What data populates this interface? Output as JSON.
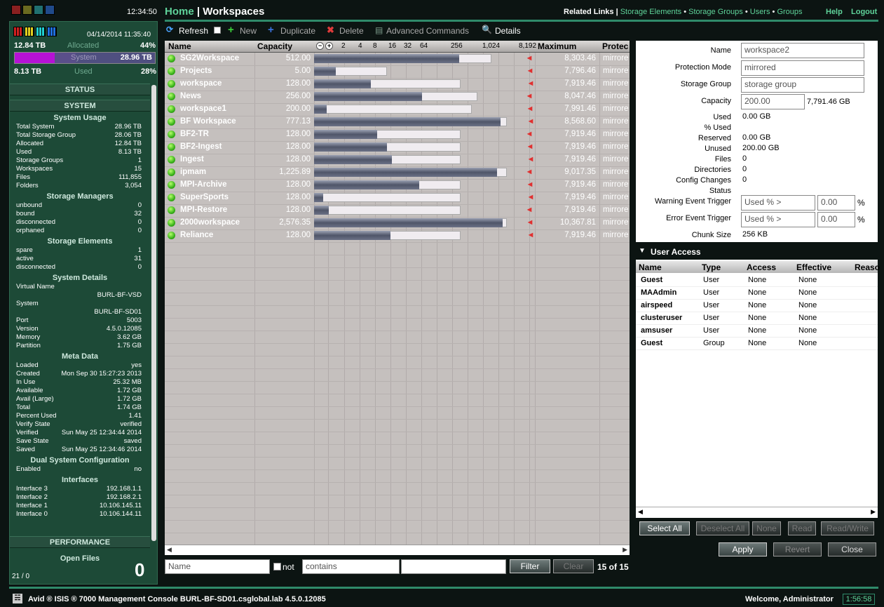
{
  "topbar": {
    "time": "12:34:50",
    "home": "Home",
    "sep": "|",
    "page": "Workspaces",
    "related": "Related Links |",
    "links": [
      "Storage Elements",
      "Storage Groups",
      "Users",
      "Groups"
    ],
    "help": "Help",
    "logout": "Logout"
  },
  "summary": {
    "date": "04/14/2014 11:35:40",
    "allocated_tb": "12.84 TB",
    "allocated_label": "Allocated",
    "allocated_pct": "44%",
    "system_label": "System",
    "system_tb": "28.96 TB",
    "used_tb": "8.13 TB",
    "used_label": "Used",
    "used_pct": "28%"
  },
  "left": {
    "status": "STATUS",
    "system": "SYSTEM",
    "sections": [
      {
        "title": "System Usage",
        "rows": [
          [
            "Total System",
            "28.96 TB"
          ],
          [
            "Total Storage Group",
            "28.06 TB"
          ],
          [
            "Allocated",
            "12.84 TB"
          ],
          [
            "Used",
            "8.13 TB"
          ],
          [
            "Storage Groups",
            "1"
          ],
          [
            "Workspaces",
            "15"
          ],
          [
            "Files",
            "111,855"
          ],
          [
            "Folders",
            "3,054"
          ]
        ]
      },
      {
        "title": "Storage Managers",
        "rows": [
          [
            "unbound",
            "0"
          ],
          [
            "bound",
            "32"
          ],
          [
            "disconnected",
            "0"
          ],
          [
            "orphaned",
            "0"
          ]
        ]
      },
      {
        "title": "Storage Elements",
        "rows": [
          [
            "spare",
            "1"
          ],
          [
            "active",
            "31"
          ],
          [
            "disconnected",
            "0"
          ]
        ]
      },
      {
        "title": "System Details",
        "rows": [
          [
            "Virtual Name",
            ""
          ],
          [
            "",
            "BURL-BF-VSD"
          ],
          [
            "System",
            ""
          ],
          [
            "",
            "BURL-BF-SD01"
          ],
          [
            "Port",
            "5003"
          ],
          [
            "Version",
            "4.5.0.12085"
          ],
          [
            "Memory",
            "3.62 GB"
          ],
          [
            "Partition",
            "1.75 GB"
          ]
        ]
      },
      {
        "title": "Meta Data",
        "rows": [
          [
            "Loaded",
            "yes"
          ],
          [
            "Created",
            "Mon Sep 30 15:27:23 2013"
          ],
          [
            "In Use",
            "25.32 MB"
          ],
          [
            "Available",
            "1.72 GB"
          ],
          [
            "Avail (Large)",
            "1.72 GB"
          ],
          [
            "Total",
            "1.74 GB"
          ],
          [
            "Percent Used",
            "1.41"
          ],
          [
            "Verify State",
            "verified"
          ],
          [
            "Verified",
            "Sun May 25 12:34:44 2014"
          ],
          [
            "Save State",
            "saved"
          ],
          [
            "Saved",
            "Sun May 25 12:34:46 2014"
          ]
        ]
      },
      {
        "title": "Dual System Configuration",
        "rows": [
          [
            "Enabled",
            "no"
          ]
        ]
      },
      {
        "title": "Interfaces",
        "rows": [
          [
            "Interface 3",
            "192.168.1.1"
          ],
          [
            "Interface 2",
            "192.168.2.1"
          ],
          [
            "Interface 1",
            "10.106.145.11"
          ],
          [
            "Interface 0",
            "10.106.144.11"
          ]
        ]
      }
    ],
    "performance": "PERFORMANCE",
    "open_files": "Open Files",
    "open_count": "0",
    "ratio": "21 / 0"
  },
  "toolbar": {
    "refresh": "Refresh",
    "new": "New",
    "duplicate": "Duplicate",
    "delete": "Delete",
    "advanced": "Advanced Commands",
    "details": "Details"
  },
  "table": {
    "headers": {
      "name": "Name",
      "capacity": "Capacity",
      "maximum": "Maximum",
      "protection": "Protec"
    },
    "scale": [
      "2",
      "4",
      "8",
      "16",
      "32",
      "64",
      "256",
      "1,024",
      "8,192"
    ],
    "rows": [
      {
        "name": "SG2Workspace",
        "capacity": "512.00",
        "maximum": "8,303.46",
        "protection": "mirrore",
        "used_frac": 0.82,
        "alloc_frac": 0.92
      },
      {
        "name": "Projects",
        "capacity": "5.00",
        "maximum": "7,796.46",
        "protection": "mirrore",
        "used_frac": 0.3,
        "alloc_frac": 0.38
      },
      {
        "name": "workspace",
        "capacity": "128.00",
        "maximum": "7,919.46",
        "protection": "mirrore",
        "used_frac": 0.39,
        "alloc_frac": 0.76
      },
      {
        "name": "News",
        "capacity": "256.00",
        "maximum": "8,047.46",
        "protection": "mirrore",
        "used_frac": 0.66,
        "alloc_frac": 0.85
      },
      {
        "name": "workspace1",
        "capacity": "200.00",
        "maximum": "7,991.46",
        "protection": "mirrore",
        "used_frac": 0.08,
        "alloc_frac": 0.82
      },
      {
        "name": "BF Workspace",
        "capacity": "777.13",
        "maximum": "8,568.60",
        "protection": "mirrore",
        "used_frac": 0.97,
        "alloc_frac": 1.0
      },
      {
        "name": "BF2-TR",
        "capacity": "128.00",
        "maximum": "7,919.46",
        "protection": "mirrore",
        "used_frac": 0.43,
        "alloc_frac": 0.76
      },
      {
        "name": "BF2-Ingest",
        "capacity": "128.00",
        "maximum": "7,919.46",
        "protection": "mirrore",
        "used_frac": 0.5,
        "alloc_frac": 0.76
      },
      {
        "name": "Ingest",
        "capacity": "128.00",
        "maximum": "7,919.46",
        "protection": "mirrore",
        "used_frac": 0.53,
        "alloc_frac": 0.76
      },
      {
        "name": "ipmam",
        "capacity": "1,225.89",
        "maximum": "9,017.35",
        "protection": "mirrore",
        "used_frac": 0.95,
        "alloc_frac": 1.0
      },
      {
        "name": "MPI-Archive",
        "capacity": "128.00",
        "maximum": "7,919.46",
        "protection": "mirrore",
        "used_frac": 0.72,
        "alloc_frac": 0.76
      },
      {
        "name": "SuperSports",
        "capacity": "128.00",
        "maximum": "7,919.46",
        "protection": "mirrore",
        "used_frac": 0.06,
        "alloc_frac": 0.76
      },
      {
        "name": "MPI-Restore",
        "capacity": "128.00",
        "maximum": "7,919.46",
        "protection": "mirrore",
        "used_frac": 0.1,
        "alloc_frac": 0.76
      },
      {
        "name": "2000workspace",
        "capacity": "2,576.35",
        "maximum": "10,367.81",
        "protection": "mirrore",
        "used_frac": 0.98,
        "alloc_frac": 1.0
      },
      {
        "name": "Reliance",
        "capacity": "128.00",
        "maximum": "7,919.46",
        "protection": "mirrore",
        "used_frac": 0.52,
        "alloc_frac": 0.76
      }
    ]
  },
  "filter": {
    "field": "Name",
    "not": "not",
    "op": "contains",
    "value": "",
    "filter_btn": "Filter",
    "clear_btn": "Clear",
    "count": "15 of 15"
  },
  "detail": {
    "name_label": "Name",
    "name": "workspace2",
    "prot_label": "Protection Mode",
    "prot": "mirrored",
    "sg_label": "Storage Group",
    "sg": "storage group",
    "cap_label": "Capacity",
    "cap": "200.00",
    "cap_max": "7,791.46 GB",
    "rows": [
      [
        "Used",
        "0.00 GB"
      ],
      [
        "% Used",
        ""
      ],
      [
        "Reserved",
        "0.00 GB"
      ],
      [
        "Unused",
        "200.00 GB"
      ],
      [
        "Files",
        "0"
      ],
      [
        "Directories",
        "0"
      ],
      [
        "Config Changes",
        "0"
      ],
      [
        "Status",
        ""
      ]
    ],
    "warn_label": "Warning Event Trigger",
    "warn_sel": "Used % >",
    "warn_val": "0.00",
    "err_label": "Error Event Trigger",
    "err_sel": "Used % >",
    "err_val": "0.00",
    "pct": "%",
    "chunk_label": "Chunk Size",
    "chunk": "256 KB"
  },
  "user_access": {
    "title": "User Access",
    "headers": [
      "Name",
      "Type",
      "Access",
      "Effective",
      "Reaso"
    ],
    "rows": [
      [
        "Guest",
        "User",
        "None",
        "None"
      ],
      [
        "MAAdmin",
        "User",
        "None",
        "None"
      ],
      [
        "airspeed",
        "User",
        "None",
        "None"
      ],
      [
        "clusteruser",
        "User",
        "None",
        "None"
      ],
      [
        "amsuser",
        "User",
        "None",
        "None"
      ],
      [
        "Guest",
        "Group",
        "None",
        "None"
      ]
    ],
    "buttons": [
      "Select All",
      "Deselect All",
      "None",
      "Read",
      "Read/Write"
    ]
  },
  "actions": {
    "apply": "Apply",
    "revert": "Revert",
    "close": "Close"
  },
  "footer": {
    "product": "Avid ® ISIS ® 7000  Management Console  BURL-BF-SD01.csglobal.lab  4.5.0.12085",
    "welcome": "Welcome, Administrator",
    "timer": "1:56:58"
  }
}
